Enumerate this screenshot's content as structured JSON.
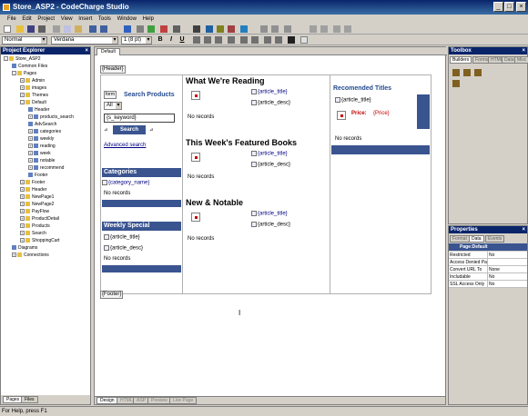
{
  "window": {
    "title": "Store_ASP2 - CodeCharge Studio"
  },
  "menu": [
    "File",
    "Edit",
    "Project",
    "View",
    "Insert",
    "Tools",
    "Window",
    "Help"
  ],
  "format": {
    "style": "Normal",
    "font": "Verdana",
    "size": "1 (8 pt)"
  },
  "explorer": {
    "title": "Project Explorer",
    "items": [
      {
        "label": "Store_ASP2",
        "indent": 0,
        "exp": "-"
      },
      {
        "label": "Common Files",
        "indent": 1,
        "exp": ""
      },
      {
        "label": "Pages",
        "indent": 1,
        "exp": "-"
      },
      {
        "label": "Admin",
        "indent": 2,
        "exp": "+"
      },
      {
        "label": "images",
        "indent": 2,
        "exp": "+"
      },
      {
        "label": "Themes",
        "indent": 2,
        "exp": "+"
      },
      {
        "label": "Default",
        "indent": 2,
        "exp": "-"
      },
      {
        "label": "Header",
        "indent": 3,
        "exp": ""
      },
      {
        "label": "products_search",
        "indent": 3,
        "exp": "+"
      },
      {
        "label": "AdvSearch",
        "indent": 3,
        "exp": ""
      },
      {
        "label": "categories",
        "indent": 3,
        "exp": "+"
      },
      {
        "label": "weekly",
        "indent": 3,
        "exp": "+"
      },
      {
        "label": "reading",
        "indent": 3,
        "exp": "+"
      },
      {
        "label": "week",
        "indent": 3,
        "exp": "+"
      },
      {
        "label": "notable",
        "indent": 3,
        "exp": "+"
      },
      {
        "label": "recommend",
        "indent": 3,
        "exp": "+"
      },
      {
        "label": "Footer",
        "indent": 3,
        "exp": ""
      },
      {
        "label": "Footer",
        "indent": 2,
        "exp": "+"
      },
      {
        "label": "Header",
        "indent": 2,
        "exp": "+"
      },
      {
        "label": "NewPage1",
        "indent": 2,
        "exp": "+"
      },
      {
        "label": "NewPage2",
        "indent": 2,
        "exp": "+"
      },
      {
        "label": "PayFlow",
        "indent": 2,
        "exp": "+"
      },
      {
        "label": "ProductDetail",
        "indent": 2,
        "exp": "+"
      },
      {
        "label": "Products",
        "indent": 2,
        "exp": "+"
      },
      {
        "label": "Search",
        "indent": 2,
        "exp": "+"
      },
      {
        "label": "ShoppingCart",
        "indent": 2,
        "exp": "+"
      },
      {
        "label": "Diagrams",
        "indent": 1,
        "exp": ""
      },
      {
        "label": "Connections",
        "indent": 1,
        "exp": "+"
      }
    ],
    "bottom_tabs": [
      "Pages",
      "Files"
    ]
  },
  "doc": {
    "tab": "Default",
    "header_tag": "{Header}",
    "footer_tag": "{Footer}",
    "search": {
      "form_tag": "form",
      "title": "Search Products",
      "select": "All",
      "keyword": "{s_keyword}",
      "button": "Search",
      "advanced": "Advanced search"
    },
    "categories": {
      "title": "Categories",
      "field": "{category_name}",
      "empty": "No records"
    },
    "weekly": {
      "title": "Weekly Special",
      "f1": "{article_title}",
      "f2": "{article_desc}",
      "empty": "No records"
    },
    "reading": {
      "title": "What We're Reading",
      "f1": "{article_title}",
      "f2": "{article_desc}",
      "empty": "No records"
    },
    "featured": {
      "title": "This Week's Featured Books",
      "f1": "{article_title}",
      "f2": "{article_desc}",
      "empty": "No records"
    },
    "notable": {
      "title": "New & Notable",
      "f1": "{article_title}",
      "f2": "{article_desc}",
      "empty": "No records"
    },
    "recommend": {
      "title": "Recomended Titles",
      "f1": "{article_title}",
      "price_label": "Price:",
      "price": "{Price}",
      "empty": "No records"
    },
    "bottom_tabs": [
      "Design",
      "HTML",
      "ASP",
      "Preview",
      "Live Page"
    ]
  },
  "toolbox": {
    "title": "Toolbox",
    "tabs": [
      "Builders",
      "Forms",
      "HTML",
      "Data",
      "Misc"
    ]
  },
  "properties": {
    "title": "Properties",
    "tabs": [
      "Format",
      "Data",
      "Events"
    ],
    "selected": "Page:Default",
    "rows": [
      {
        "k": "Restricted",
        "v": "No"
      },
      {
        "k": "Access Denied Pa",
        "v": ""
      },
      {
        "k": "Convert URL To",
        "v": "None"
      },
      {
        "k": "Includable",
        "v": "No"
      },
      {
        "k": "SSL Access Only",
        "v": "No"
      }
    ]
  },
  "status": "For Help, press F1",
  "colors": {
    "title_start": "#0a246a",
    "title_end": "#3a6ea5",
    "section_header": "#3a5490",
    "chrome": "#d4d0c8"
  }
}
